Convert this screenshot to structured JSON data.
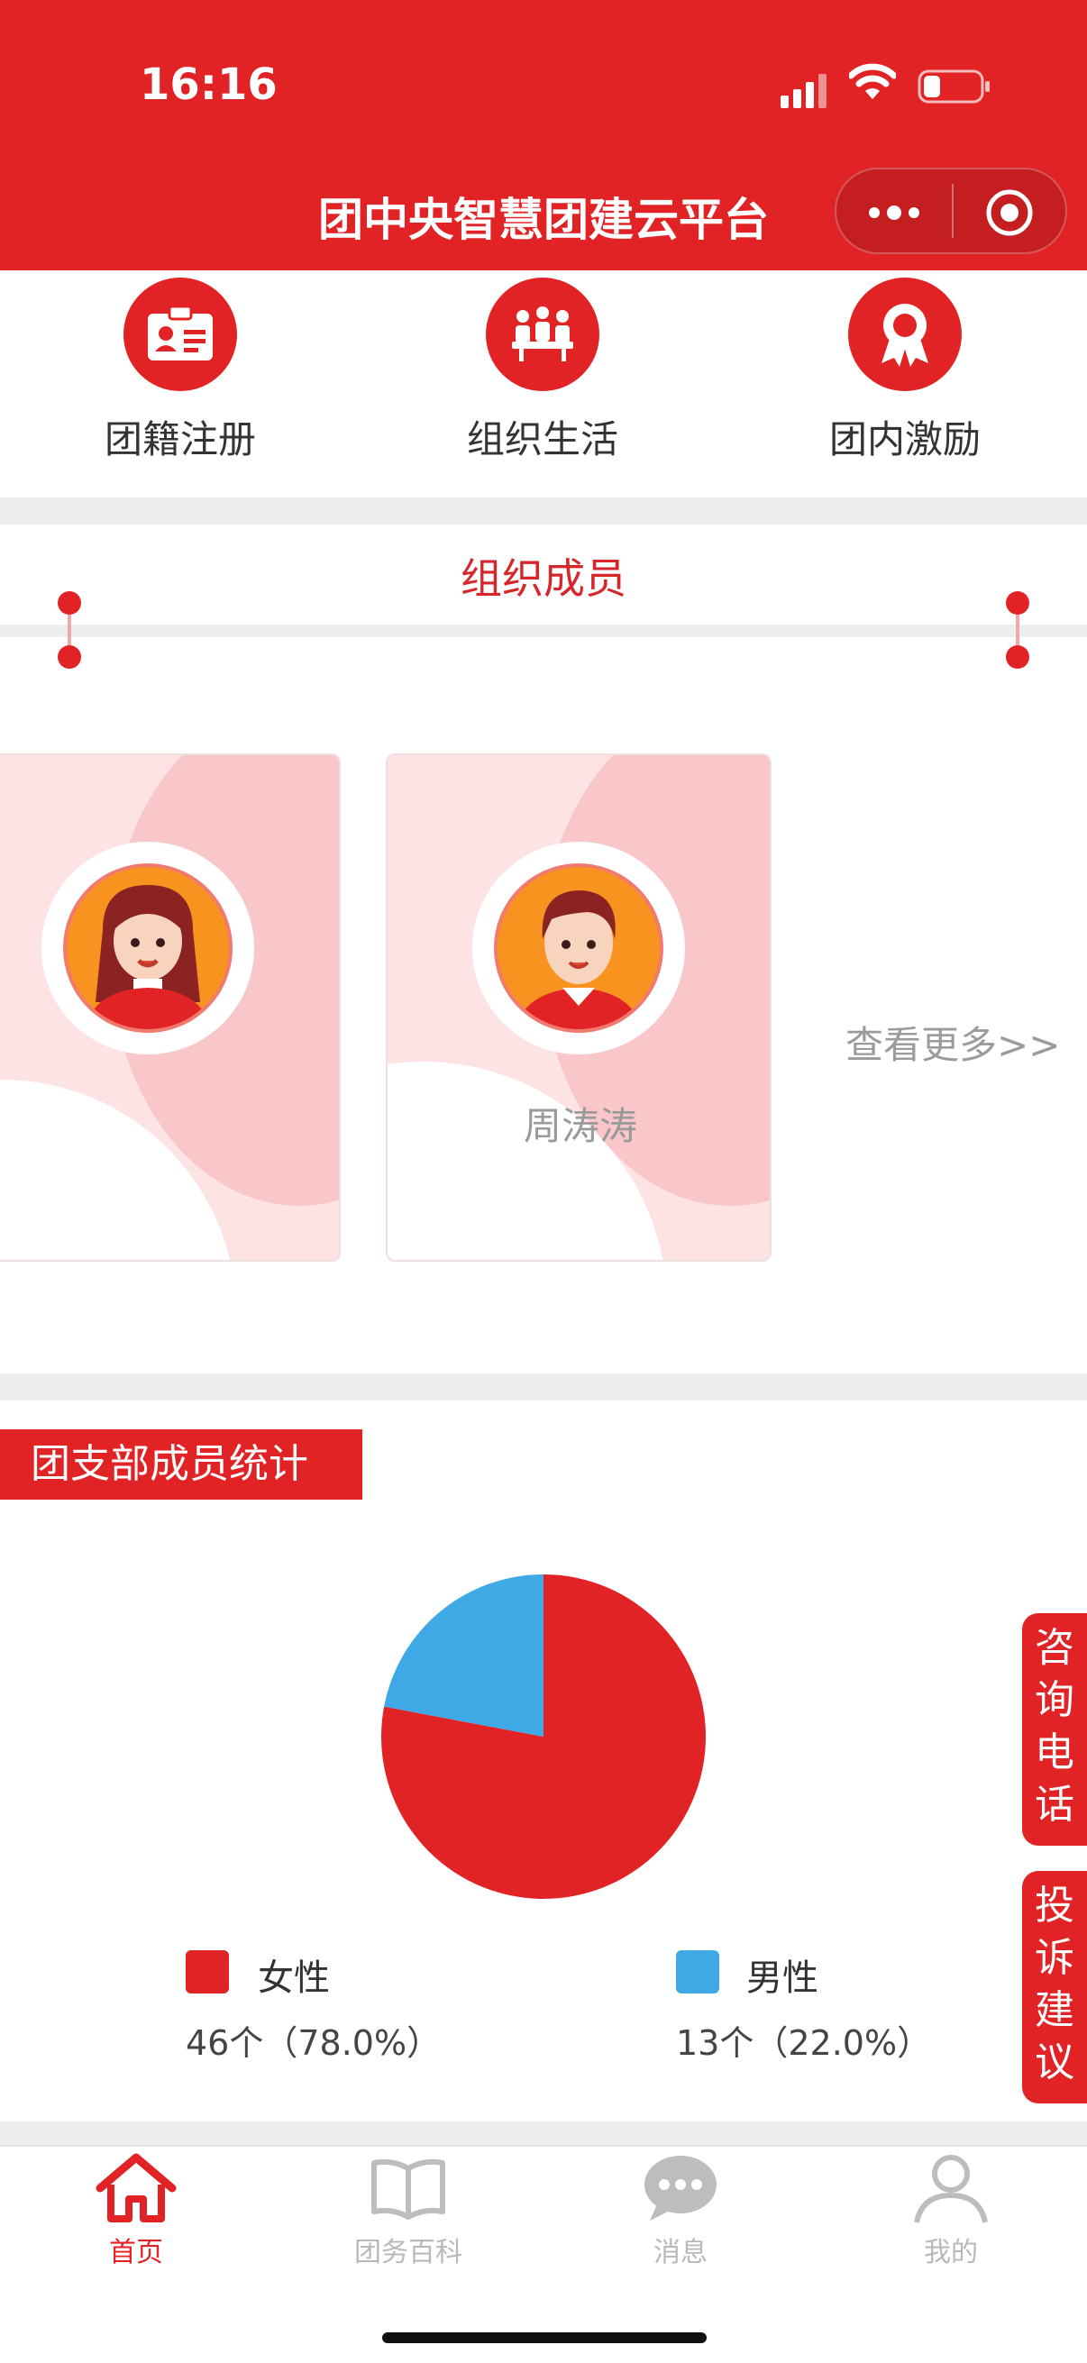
{
  "status_bar": {
    "time": "16:16"
  },
  "header": {
    "title": "团中央智慧团建云平台",
    "menu_icon": "more-dots-icon",
    "close_icon": "target-circle-icon"
  },
  "quick_actions": [
    {
      "label": "团籍注册",
      "icon": "id-card-icon"
    },
    {
      "label": "组织生活",
      "icon": "group-meeting-icon"
    },
    {
      "label": "团内激励",
      "icon": "award-ribbon-icon"
    }
  ],
  "members_section": {
    "title": "组织成员",
    "members": [
      {
        "name": "",
        "phone": "",
        "avatar": "female-avatar"
      },
      {
        "name": "周涛涛",
        "phone": "",
        "avatar": "male-avatar"
      }
    ],
    "more_link": "查看更多>>"
  },
  "stats": {
    "title": "团支部成员统计",
    "legend": [
      {
        "label": "女性",
        "value": "46个（78.0%）",
        "color": "#e12326"
      },
      {
        "label": "男性",
        "value": "13个（22.0%）",
        "color": "#3fa9e6"
      }
    ]
  },
  "chart_data": {
    "type": "pie",
    "categories": [
      "女性",
      "男性"
    ],
    "values": [
      46,
      13
    ],
    "colors": [
      "#e12326",
      "#3fa9e6"
    ]
  },
  "side_buttons": {
    "consult": "咨询电话",
    "complaint": "投诉建议"
  },
  "tabbar": [
    {
      "label": "首页",
      "icon": "home-icon",
      "active": true
    },
    {
      "label": "团务百科",
      "icon": "book-icon",
      "active": false
    },
    {
      "label": "消息",
      "icon": "chat-bubble-icon",
      "active": false
    },
    {
      "label": "我的",
      "icon": "user-icon",
      "active": false
    }
  ],
  "colors": {
    "brand": "#e12326",
    "male": "#3fa9e6",
    "card_bg": "#fde3e4"
  }
}
